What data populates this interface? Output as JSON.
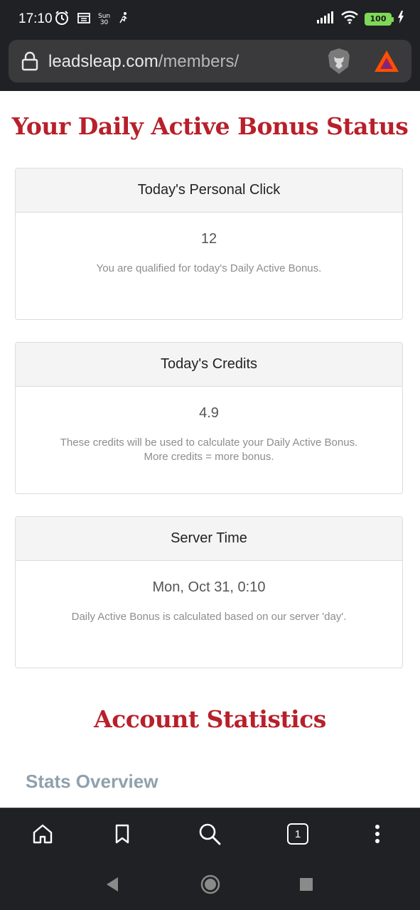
{
  "status_bar": {
    "time": "17:10",
    "day": "Sun",
    "date": "30",
    "battery": "100"
  },
  "browser": {
    "url_domain": "leadsleap.com",
    "url_path": "/members/",
    "tab_count": "1"
  },
  "page": {
    "daily_title": "Your Daily Active Bonus Status",
    "cards": [
      {
        "header": "Today's Personal Click",
        "value": "12",
        "desc": "You are qualified for today's Daily Active Bonus."
      },
      {
        "header": "Today's Credits",
        "value": "4.9",
        "desc_line1": "These credits will be used to calculate your Daily Active Bonus.",
        "desc_line2": "More credits = more bonus."
      },
      {
        "header": "Server Time",
        "value": "Mon, Oct 31, 0:10",
        "desc": "Daily Active Bonus is calculated based on our server 'day'."
      }
    ],
    "account_title": "Account Statistics",
    "stats_overview": "Stats Overview"
  },
  "colors": {
    "heading_red": "#b8202a",
    "stats_grey": "#8fa1ad",
    "dark_chrome": "#202124"
  }
}
